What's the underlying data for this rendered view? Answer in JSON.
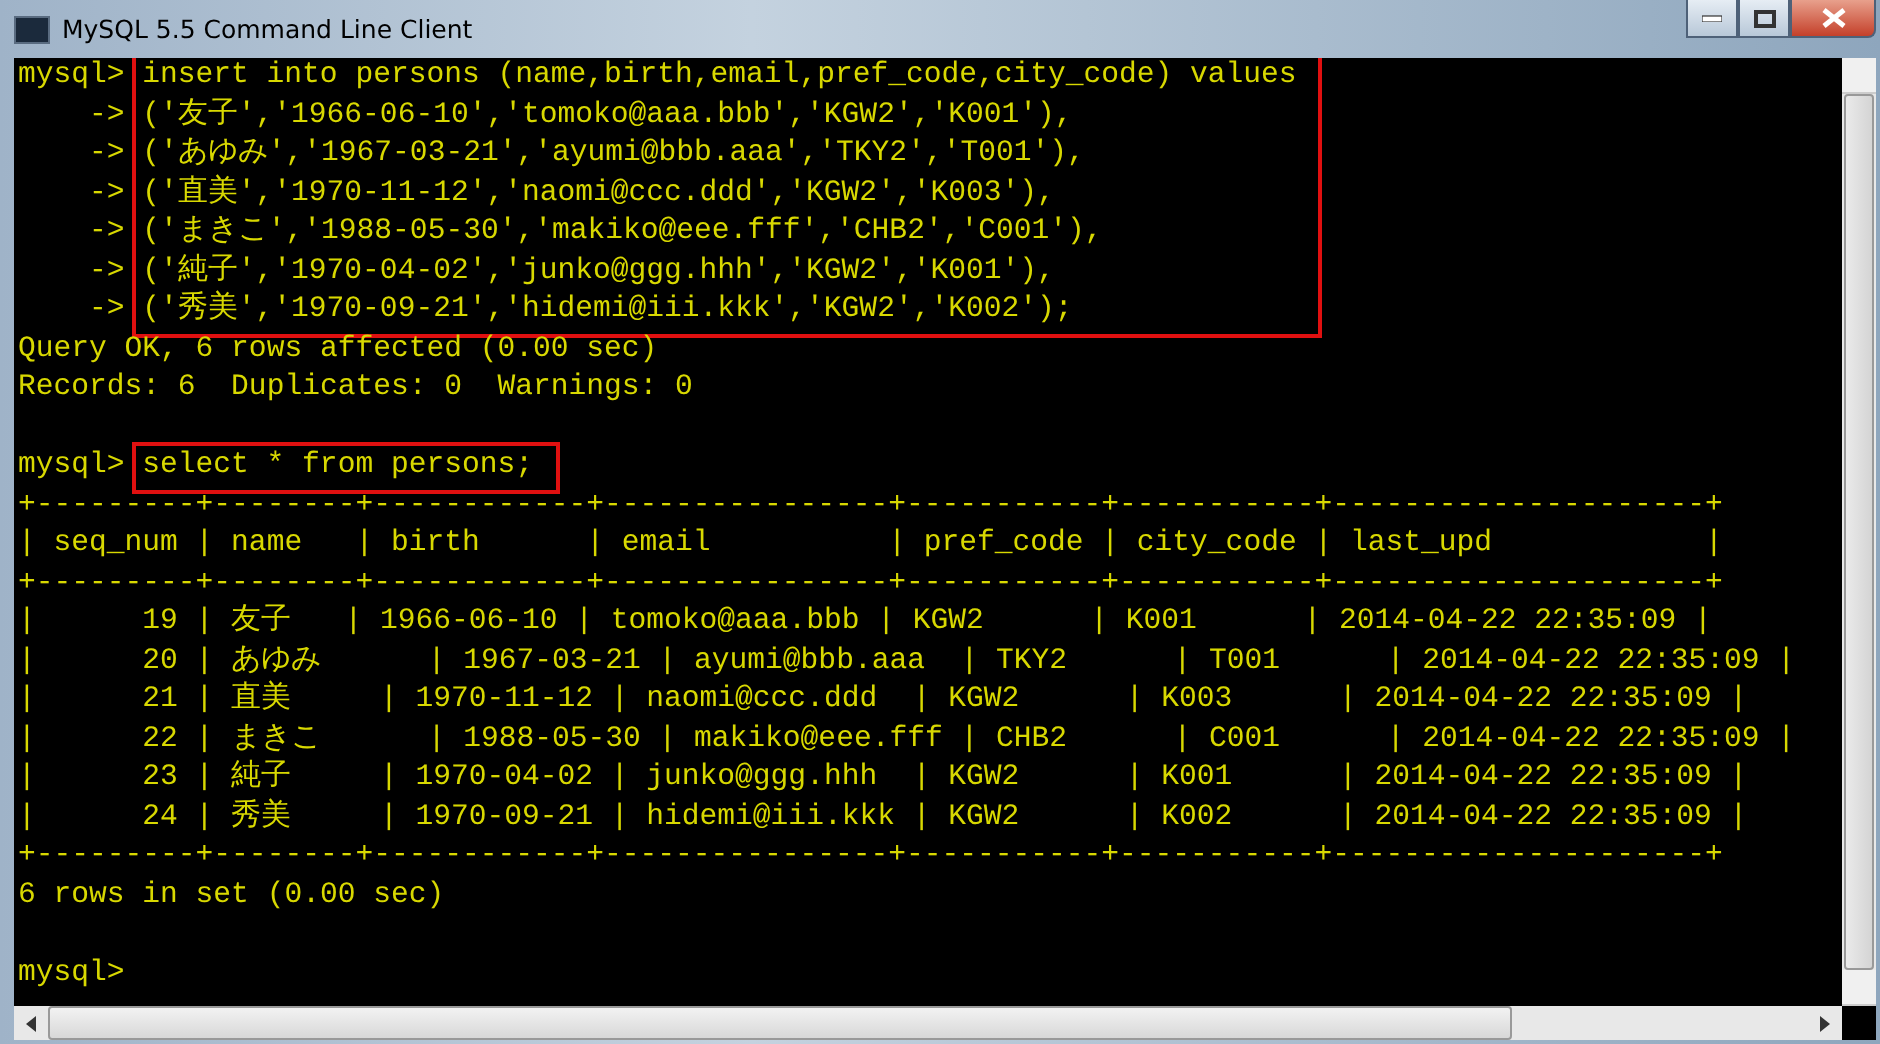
{
  "window": {
    "title": "MySQL 5.5 Command Line Client"
  },
  "console": {
    "lines": [
      {
        "kind": "boxed",
        "lines": [
          {
            "prompt": "mysql>",
            "text": "insert into persons (name,birth,email,pref_code,city_code) values"
          },
          {
            "prompt": "->",
            "text": "('友子','1966-06-10','tomoko@aaa.bbb','KGW2','K001'),"
          },
          {
            "prompt": "->",
            "text": "('あゆみ','1967-03-21','ayumi@bbb.aaa','TKY2','T001'),"
          },
          {
            "prompt": "->",
            "text": "('直美','1970-11-12','naomi@ccc.ddd','KGW2','K003'),"
          },
          {
            "prompt": "->",
            "text": "('まきこ','1988-05-30','makiko@eee.fff','CHB2','C001'),"
          },
          {
            "prompt": "->",
            "text": "('純子','1970-04-02','junko@ggg.hhh','KGW2','K001'),"
          },
          {
            "prompt": "->",
            "text": "('秀美','1970-09-21','hidemi@iii.kkk','KGW2','K002');"
          }
        ]
      },
      {
        "kind": "output",
        "text": "Query OK, 6 rows affected (0.00 sec)"
      },
      {
        "kind": "output",
        "text": "Records: 6  Duplicates: 0  Warnings: 0"
      },
      {
        "kind": "blank"
      },
      {
        "kind": "boxed",
        "lines": [
          {
            "prompt": "mysql>",
            "text": "select * from persons;"
          }
        ]
      },
      {
        "kind": "output",
        "text": "+---------+--------+------------+----------------+-----------+-----------+---------------------+"
      },
      {
        "kind": "output",
        "text": "| seq_num | name   | birth      | email          | pref_code | city_code | last_upd            |"
      },
      {
        "kind": "output",
        "text": "+---------+--------+------------+----------------+-----------+-----------+---------------------+"
      },
      {
        "kind": "output",
        "text": "|      19 | 友子   | 1966-06-10 | tomoko@aaa.bbb | KGW2      | K001      | 2014-04-22 22:35:09 |"
      },
      {
        "kind": "output",
        "text": "|      20 | あゆみ      | 1967-03-21 | ayumi@bbb.aaa  | TKY2      | T001      | 2014-04-22 22:35:09 |"
      },
      {
        "kind": "output",
        "text": "|      21 | 直美     | 1970-11-12 | naomi@ccc.ddd  | KGW2      | K003      | 2014-04-22 22:35:09 |"
      },
      {
        "kind": "output",
        "text": "|      22 | まきこ      | 1988-05-30 | makiko@eee.fff | CHB2      | C001      | 2014-04-22 22:35:09 |"
      },
      {
        "kind": "output",
        "text": "|      23 | 純子     | 1970-04-02 | junko@ggg.hhh  | KGW2      | K001      | 2014-04-22 22:35:09 |"
      },
      {
        "kind": "output",
        "text": "|      24 | 秀美     | 1970-09-21 | hidemi@iii.kkk | KGW2      | K002      | 2014-04-22 22:35:09 |"
      },
      {
        "kind": "output",
        "text": "+---------+--------+------------+----------------+-----------+-----------+---------------------+"
      },
      {
        "kind": "output",
        "text": "6 rows in set (0.00 sec)"
      },
      {
        "kind": "blank"
      },
      {
        "kind": "input",
        "prompt": "mysql>"
      }
    ]
  }
}
